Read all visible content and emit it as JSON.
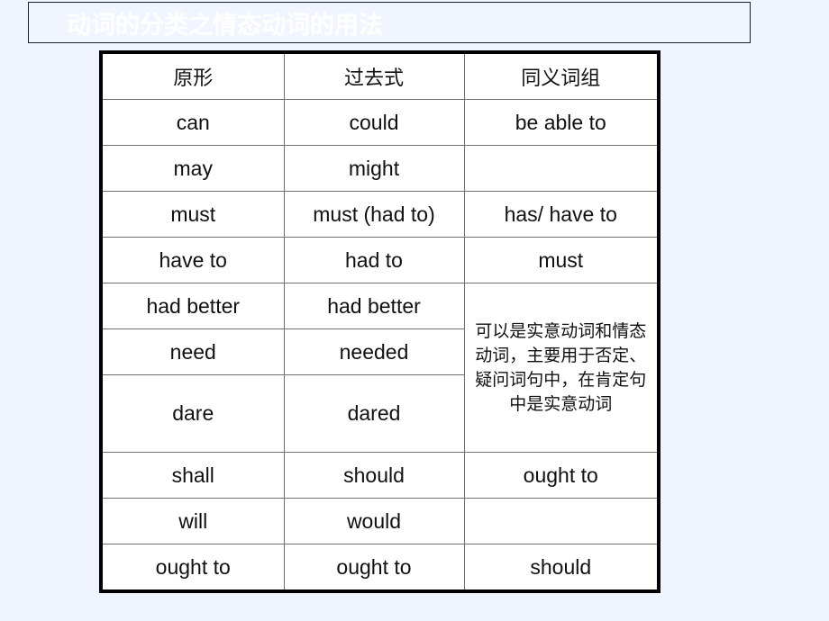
{
  "slide": {
    "background_color": "#eff4fe",
    "title": {
      "text": "动词的分类之情态动词的用法",
      "text_color": "#ffffff",
      "box_fill": "#f0f5ff",
      "box_border_color": "#1c1f2b"
    }
  },
  "table": {
    "border_color": "#000000",
    "grid_color": "#6f6f6f",
    "headers": [
      "原形",
      "过去式",
      "同义词组"
    ],
    "rows": [
      {
        "base": "can",
        "past": "could",
        "synonym": "be able to"
      },
      {
        "base": "may",
        "past": "might",
        "synonym": ""
      },
      {
        "base": "must",
        "past": "must (had to)",
        "synonym": "has/ have to"
      },
      {
        "base": "have to",
        "past": "had to",
        "synonym": "must"
      },
      {
        "base": "had better",
        "past": "had better",
        "synonym": null
      },
      {
        "base": "need",
        "past": "needed",
        "synonym": null
      },
      {
        "base": "dare",
        "past": "dared",
        "synonym": null
      },
      {
        "base": "shall",
        "past": "should",
        "synonym": "ought to"
      },
      {
        "base": "will",
        "past": "would",
        "synonym": ""
      },
      {
        "base": "ought to",
        "past": "ought to",
        "synonym": "should"
      }
    ],
    "merged_note": "可以是实意动词和情态动词，主要用于否定、疑问词句中，在肯定句中是实意动词"
  }
}
